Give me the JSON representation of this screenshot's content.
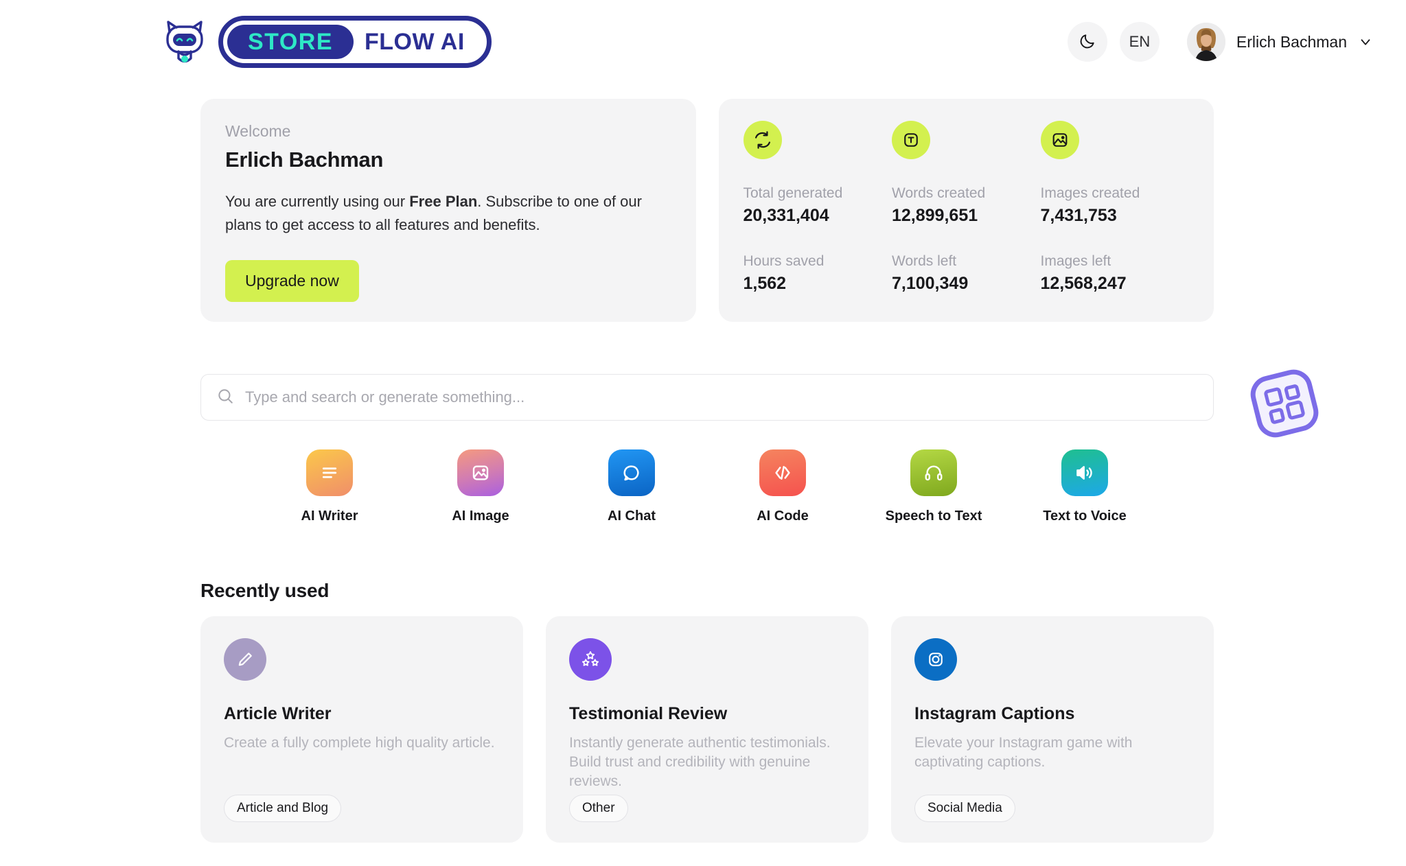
{
  "brand": {
    "mark_icon": "robot-cat-logo-icon",
    "pill_primary": "STORE",
    "pill_secondary": "FLOW AI"
  },
  "header": {
    "theme_toggle_icon": "moon-icon",
    "language": "EN",
    "user_name": "Erlich Bachman",
    "avatar_icon": "user-avatar",
    "chevron_icon": "chevron-down-icon"
  },
  "welcome": {
    "label": "Welcome",
    "name": "Erlich Bachman",
    "desc_part1": "You are currently using our ",
    "desc_plan": "Free Plan",
    "desc_part2": ". Subscribe to one of our plans to get access to all features and benefits.",
    "upgrade_label": "Upgrade now",
    "upgrade_color": "#d3f04f"
  },
  "stats": {
    "icon_bg": "#d3f04f",
    "items": [
      {
        "icon": "refresh-icon",
        "label": "Total generated",
        "value": "20,331,404"
      },
      {
        "icon": "text-box-icon",
        "label": "Words created",
        "value": "12,899,651"
      },
      {
        "icon": "image-icon",
        "label": "Images created",
        "value": "7,431,753"
      }
    ],
    "lower": [
      {
        "label": "Hours saved",
        "value": "1,562"
      },
      {
        "label": "Words left",
        "value": "7,100,349"
      },
      {
        "label": "Images left",
        "value": "12,568,247"
      }
    ]
  },
  "search": {
    "icon": "search-icon",
    "placeholder": "Type and search or generate something...",
    "value": ""
  },
  "actions": [
    {
      "label": "AI Writer",
      "icon": "lines-icon",
      "color_from": "#fbc84a",
      "color_to": "#f08e6a"
    },
    {
      "label": "AI Image",
      "icon": "image-icon",
      "color_from": "#f59a7e",
      "color_to": "#a95fe0"
    },
    {
      "label": "AI Chat",
      "icon": "chat-bubble-icon",
      "color_from": "#2196f3",
      "color_to": "#0b64c4"
    },
    {
      "label": "AI Code",
      "icon": "code-brackets-icon",
      "color_from": "#f5845f",
      "color_to": "#f5524e"
    },
    {
      "label": "Speech to Text",
      "icon": "headphones-icon",
      "color_from": "#b4d844",
      "color_to": "#7fa81e"
    },
    {
      "label": "Text to Voice",
      "icon": "speaker-wave-icon",
      "color_from": "#1fbf8f",
      "color_to": "#1da8e8"
    }
  ],
  "recent": {
    "title": "Recently used",
    "cards": [
      {
        "icon": "pencil-icon",
        "icon_bg": "#a79cc4",
        "title": "Article Writer",
        "desc": "Create a fully complete high quality article.",
        "tag": "Article and Blog"
      },
      {
        "icon": "three-stars-icon",
        "icon_bg": "#7c52e8",
        "title": "Testimonial Review",
        "desc": "Instantly generate authentic testimonials. Build trust and credibility with genuine reviews.",
        "tag": "Other"
      },
      {
        "icon": "instagram-icon",
        "icon_bg": "#0b6ec4",
        "title": "Instagram Captions",
        "desc": "Elevate your Instagram game with captivating captions.",
        "tag": "Social Media"
      }
    ]
  },
  "widget": {
    "icon": "grid-dashboard-icon",
    "color": "#7c6ce8"
  }
}
